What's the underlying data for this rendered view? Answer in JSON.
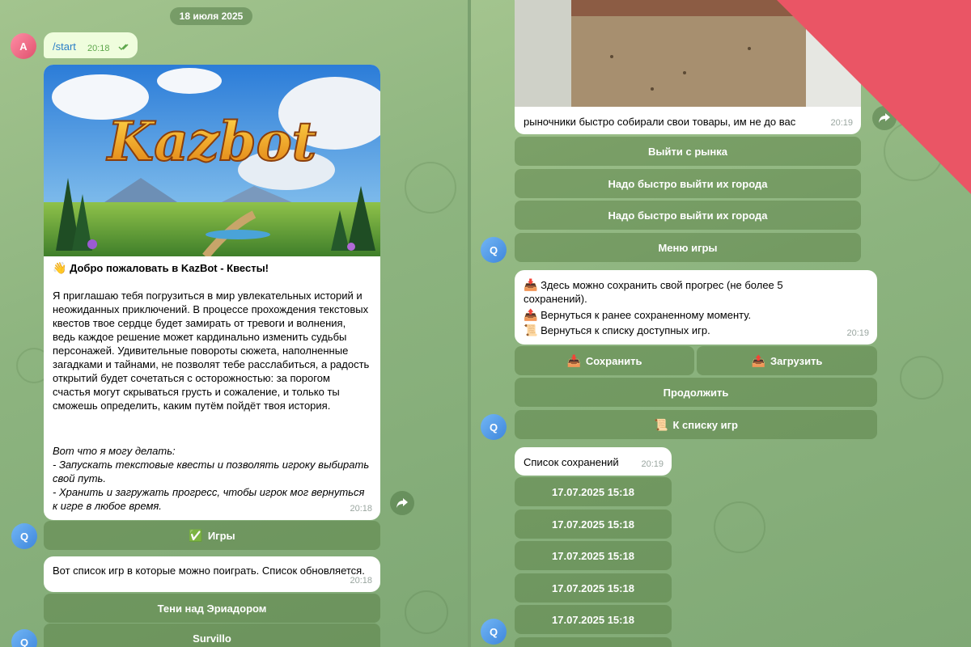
{
  "left": {
    "date_separator": "18 июля 2025",
    "start_msg": {
      "avatar": "A",
      "text": "/start",
      "time": "20:18"
    },
    "welcome": {
      "image_logo_text": "Kazbot",
      "title": "Добро пожаловать в KazBot - Квесты!",
      "title_emoji": "👋",
      "paragraph": "Я приглашаю тебя погрузиться в мир увлекательных историй и неожиданных приключений. В процессе прохождения текстовых квестов твое сердце будет замирать от тревоги и волнения, ведь каждое решение может кардинально изменить судьбы персонажей. Удивительные повороты сюжета, наполненные загадками и тайнами, не позволят тебе расслабиться, а радость открытий будет сочетаться с осторожностью: за порогом счастья могут скрываться грусть и сожаление, и только ты сможешь определить, каким путём пойдёт твоя история.",
      "can_do_heading": "Вот что я могу делать:",
      "can_do_1": "- Запускать текстовые квесты и позволять игроку выбирать свой путь.",
      "can_do_2": "- Хранить и загружать прогресс, чтобы игрок мог вернуться к игре в любое время.",
      "time": "20:18"
    },
    "games_button": {
      "emoji": "✅",
      "label": "Игры"
    },
    "games_list": {
      "text": "Вот список игр в которые можно поиграть. Список обновляется.",
      "time": "20:18"
    },
    "game_buttons": [
      "Тени над Эриадором",
      "Survillo"
    ],
    "bot_avatar": "Q"
  },
  "right": {
    "market": {
      "text": "рыночники быстро собирали свои товары, им не до вас",
      "time": "20:19"
    },
    "market_buttons": [
      "Выйти с рынка",
      "Надо быстро выйти их города",
      "Надо быстро выйти их города",
      "Меню игры"
    ],
    "save_menu": {
      "line1_emoji": "📥",
      "line1": "Здесь можно сохранить свой прогрес (не более 5 сохранений).",
      "line2_emoji": "📤",
      "line2": "Вернуться к ранее сохраненному моменту.",
      "line3_emoji": "📜",
      "line3": "Вернуться к списку доступных игр.",
      "time": "20:19"
    },
    "save_button": {
      "emoji": "📥",
      "label": "Сохранить"
    },
    "load_button": {
      "emoji": "📤",
      "label": "Загрузить"
    },
    "continue_button": "Продолжить",
    "games_list_button": {
      "emoji": "📜",
      "label": "К списку игр"
    },
    "saves_list": {
      "text": "Список сохранений",
      "time": "20:19"
    },
    "save_slots": [
      "17.07.2025 15:18",
      "17.07.2025 15:18",
      "17.07.2025 15:18",
      "17.07.2025 15:18",
      "17.07.2025 15:18"
    ],
    "bot_avatar": "Q"
  },
  "colors": {
    "outgoing": "#effddd",
    "button": "#6f9a5c",
    "accent_avatar": "#3e86dc",
    "corner": "#ea5565"
  }
}
